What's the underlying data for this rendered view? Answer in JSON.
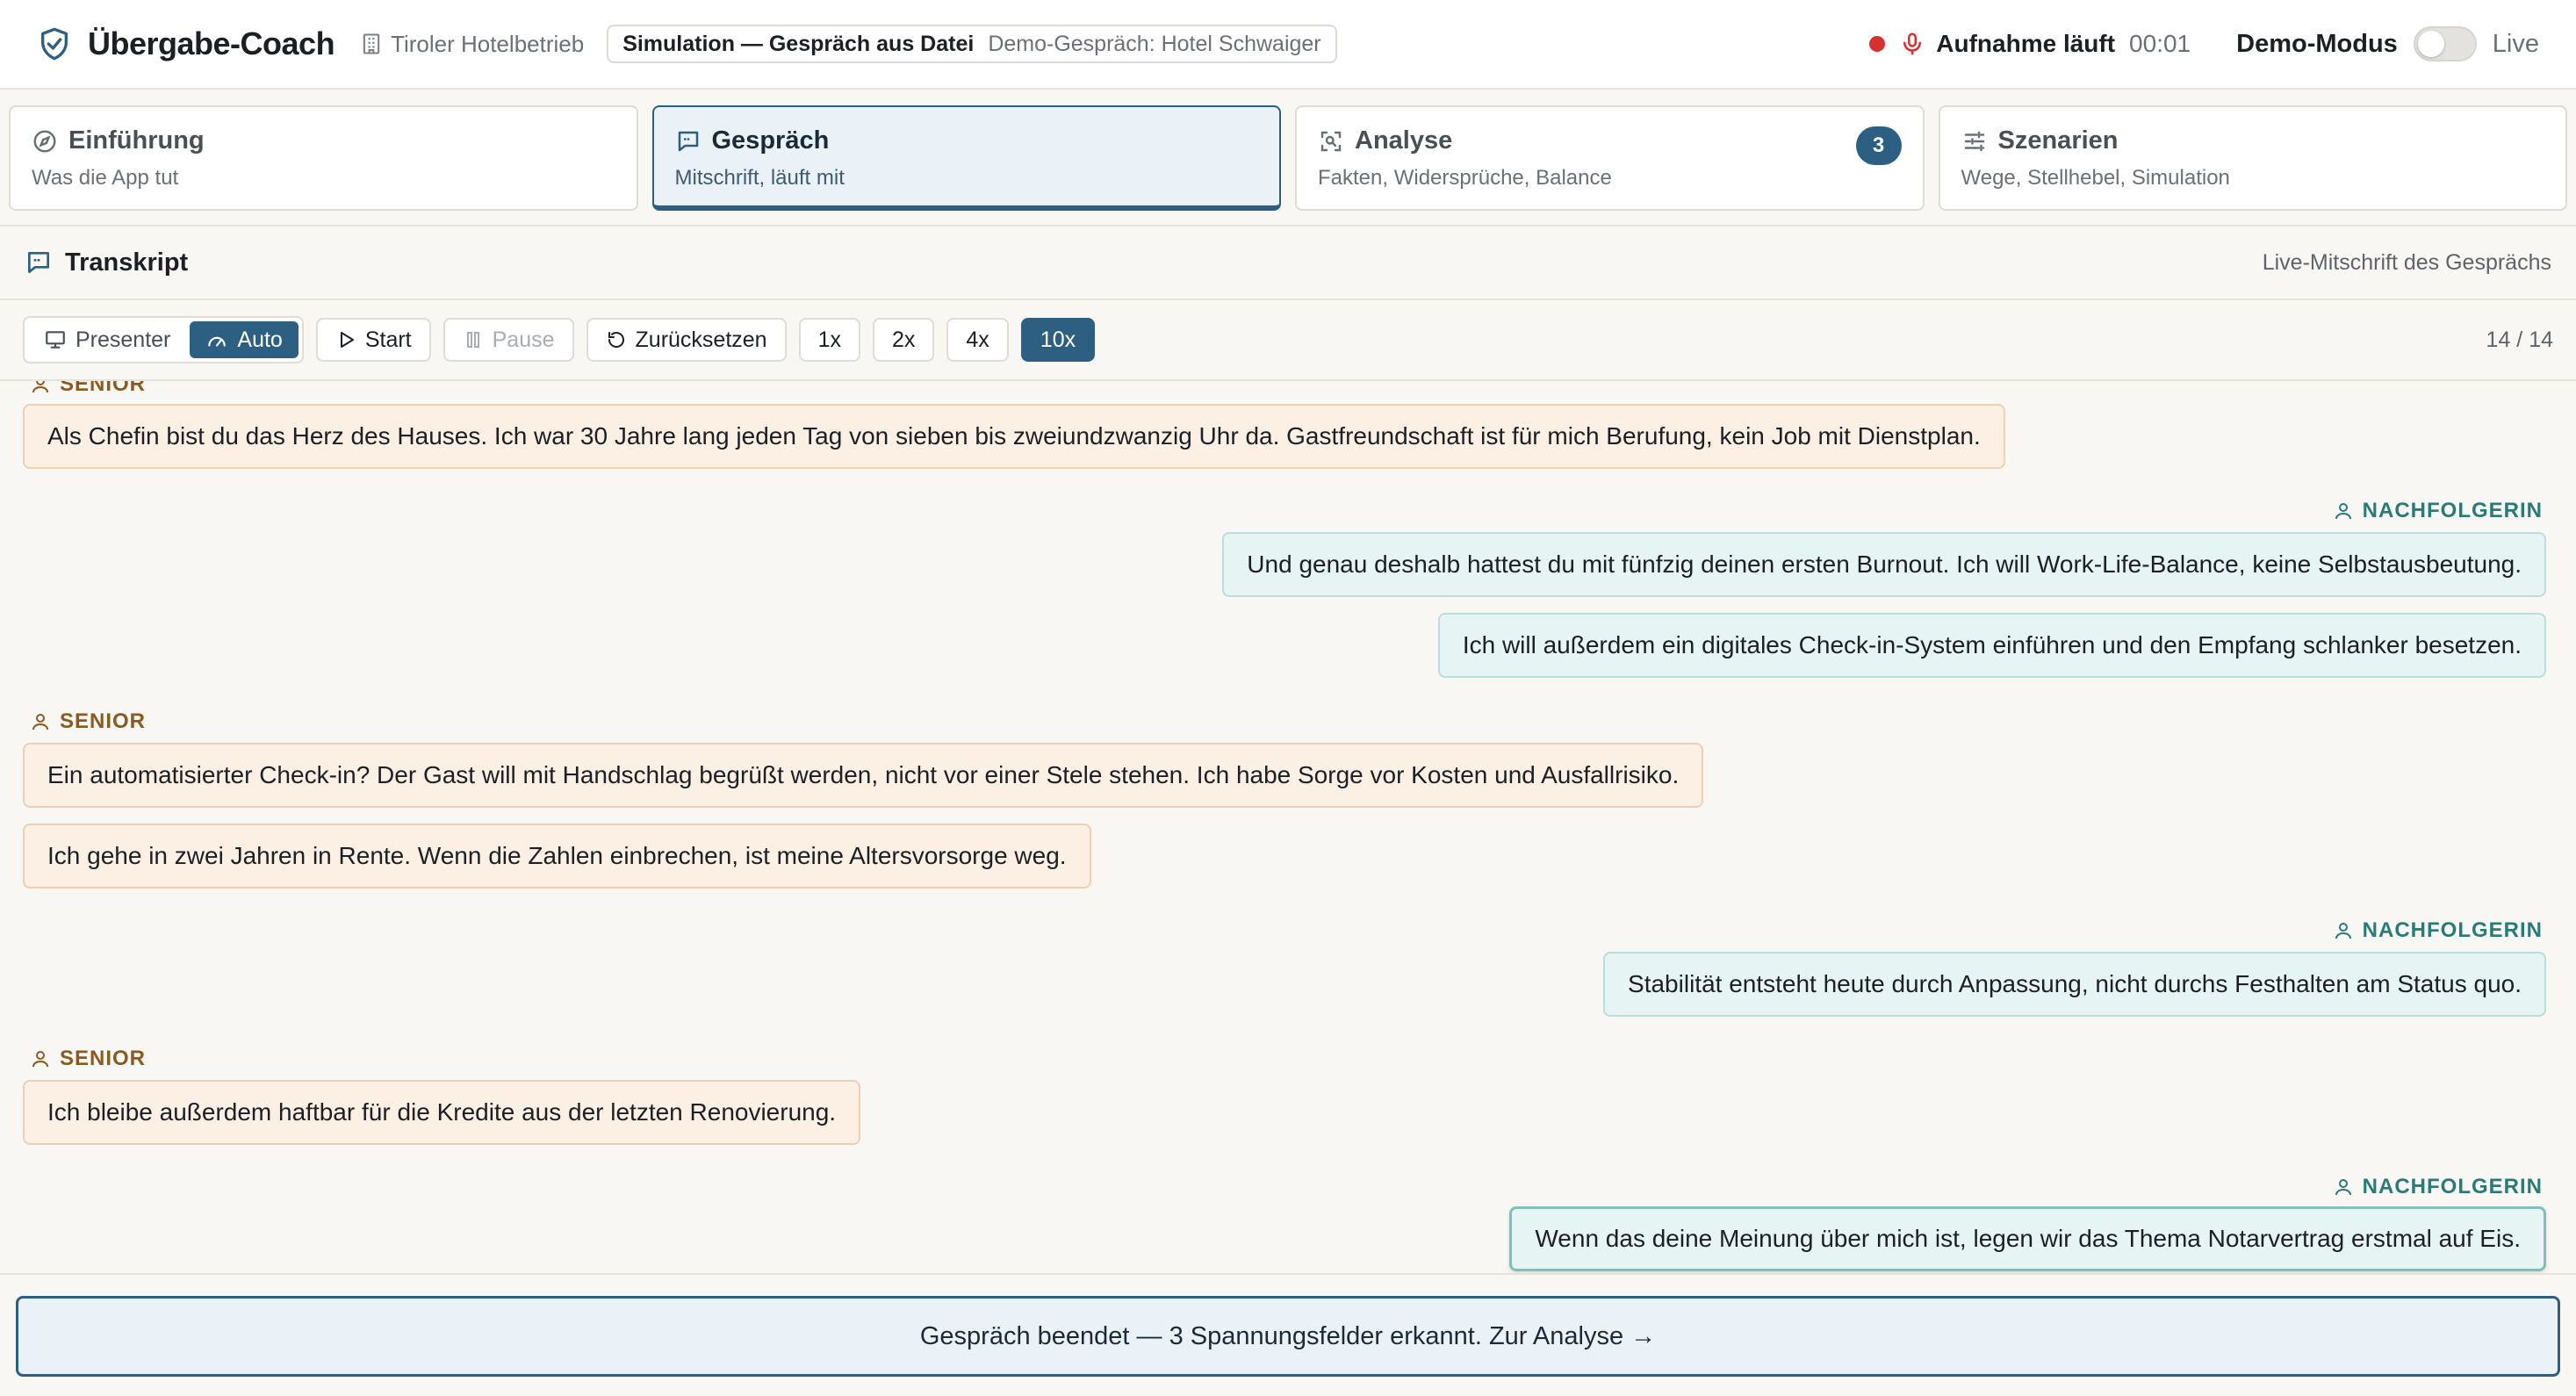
{
  "header": {
    "app_title": "Übergabe-Coach",
    "org_label": "Tiroler Hotelbetrieb",
    "sim_mode": "Simulation — Gespräch aus Datei",
    "sim_source": "Demo-Gespräch: Hotel Schwaiger",
    "rec_label": "Aufnahme läuft",
    "rec_time": "00:01",
    "demo_label": "Demo-Modus",
    "demo_toggle_on": false,
    "live_label": "Live",
    "accent_color": "#2d5f82",
    "rec_color": "#d6302f"
  },
  "tabs": [
    {
      "title": "Einführung",
      "subtitle": "Was die App tut",
      "icon": "compass-icon",
      "active": false
    },
    {
      "title": "Gespräch",
      "subtitle": "Mitschrift, läuft mit",
      "icon": "chat-icon",
      "active": true
    },
    {
      "title": "Analyse",
      "subtitle": "Fakten, Widersprüche, Balance",
      "icon": "scan-icon",
      "active": false,
      "badge": "3"
    },
    {
      "title": "Szenarien",
      "subtitle": "Wege, Stellhebel, Simulation",
      "icon": "sliders-icon",
      "active": false
    }
  ],
  "transcript": {
    "title": "Transkript",
    "subtitle": "Live-Mitschrift des Gesprächs"
  },
  "toolbar": {
    "presenter_label": "Presenter",
    "auto_label": "Auto",
    "mode_selected": "Auto",
    "start_label": "Start",
    "pause_label": "Pause",
    "reset_label": "Zurücksetzen",
    "speeds": [
      "1x",
      "2x",
      "4x",
      "10x"
    ],
    "speed_selected": "10x",
    "count": "14 / 14"
  },
  "messages": [
    {
      "speaker": "senior",
      "label": "SENIOR",
      "text": "Als Chefin bist du das Herz des Hauses. Ich war 30 Jahre lang jeden Tag von sieben bis zweiundzwanzig Uhr da. Gastfreundschaft ist für mich Berufung, kein Job mit Dienstplan."
    },
    {
      "speaker": "succ",
      "label": "NACHFOLGERIN",
      "text": "Und genau deshalb hattest du mit fünfzig deinen ersten Burnout. Ich will Work-Life-Balance, keine Selbstausbeutung."
    },
    {
      "speaker": "succ",
      "text": "Ich will außerdem ein digitales Check-in-System einführen und den Empfang schlanker besetzen."
    },
    {
      "speaker": "senior",
      "label": "SENIOR",
      "text": "Ein automatisierter Check-in? Der Gast will mit Handschlag begrüßt werden, nicht vor einer Stele stehen. Ich habe Sorge vor Kosten und Ausfallrisiko."
    },
    {
      "speaker": "senior",
      "text": "Ich gehe in zwei Jahren in Rente. Wenn die Zahlen einbrechen, ist meine Altersvorsorge weg."
    },
    {
      "speaker": "succ",
      "label": "NACHFOLGERIN",
      "text": "Stabilität entsteht heute durch Anpassung, nicht durchs Festhalten am Status quo."
    },
    {
      "speaker": "senior",
      "label": "SENIOR",
      "text": "Ich bleibe außerdem haftbar für die Kredite aus der letzten Renovierung."
    },
    {
      "speaker": "succ",
      "label": "NACHFOLGERIN",
      "text": "Wenn das deine Meinung über mich ist, legen wir das Thema Notarvertrag erstmal auf Eis."
    }
  ],
  "footer": {
    "cta_label": "Gespräch beendet — 3 Spannungsfelder erkannt. Zur Analyse →"
  }
}
